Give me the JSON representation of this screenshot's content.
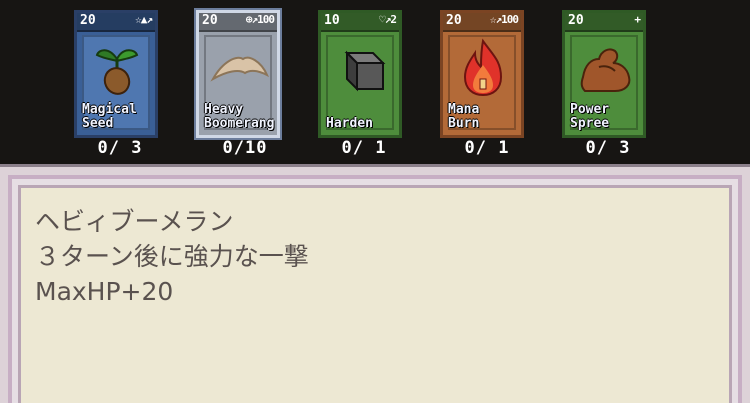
{
  "cards": [
    {
      "cost": "20",
      "icons": "☆▲↗",
      "name": "Magical\nSeed",
      "count": "0/ 3",
      "theme": "blue",
      "art": "seed-icon"
    },
    {
      "cost": "20",
      "icons": "⊕↗100",
      "name": "Heavy\nBoomerang",
      "count": "0/10",
      "theme": "grey",
      "art": "boomerang-icon"
    },
    {
      "cost": "10",
      "icons": "♡↗2",
      "name": "Harden",
      "count": "0/ 1",
      "theme": "green",
      "art": "cube-icon"
    },
    {
      "cost": "20",
      "icons": "☆↗100",
      "name": "Mana\nBurn",
      "count": "0/ 1",
      "theme": "orange",
      "art": "flame-icon"
    },
    {
      "cost": "20",
      "icons": "+",
      "name": "Power\nSpree",
      "count": "0/ 3",
      "theme": "green",
      "art": "arm-icon"
    }
  ],
  "description": {
    "line1": "ヘビィブーメラン",
    "line2": "３ターン後に強力な一撃",
    "line3": "MaxHP+20"
  }
}
